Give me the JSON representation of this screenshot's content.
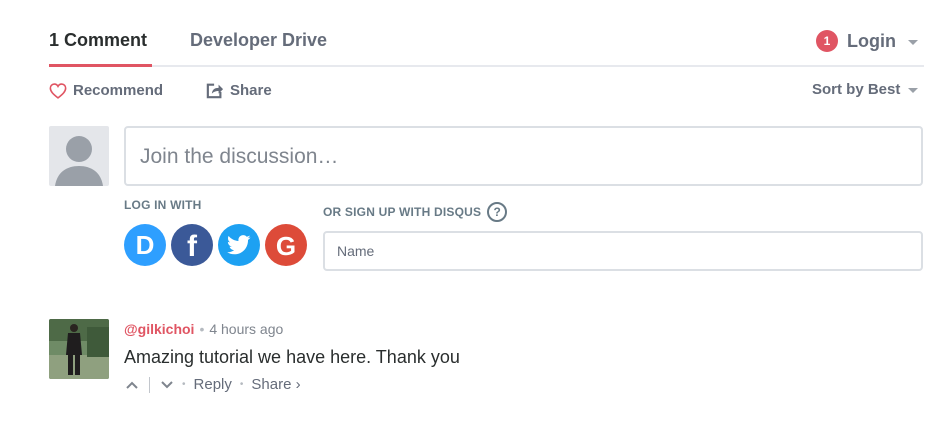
{
  "nav": {
    "comment_count_tab": "1 Comment",
    "community_tab": "Developer Drive",
    "notification_count": "1",
    "login_label": "Login"
  },
  "toolbar": {
    "recommend_label": "Recommend",
    "share_label": "Share",
    "sort_label": "Sort by Best"
  },
  "composer": {
    "placeholder": "Join the discussion…",
    "log_in_with_label": "LOG IN WITH",
    "sign_up_label": "OR SIGN UP WITH DISQUS",
    "help_glyph": "?",
    "name_placeholder": "Name",
    "social_providers": [
      {
        "name": "disqus-icon",
        "glyph": "D",
        "color": "#2e9fff"
      },
      {
        "name": "facebook-icon",
        "glyph": "f",
        "color": "#3b5998"
      },
      {
        "name": "twitter-icon",
        "glyph": "twitter-bird",
        "color": "#1da1f2"
      },
      {
        "name": "google-icon",
        "glyph": "G",
        "color": "#dd4b39"
      }
    ]
  },
  "comment": {
    "username": "@gilkichoi",
    "separator": "•",
    "time": "4 hours ago",
    "body": "Amazing tutorial we have here. Thank you",
    "reply_label": "Reply",
    "share_label": "Share ›"
  },
  "colors": {
    "accent": "#e05563",
    "muted_text": "#656c7a",
    "border": "#dbdfe4"
  }
}
